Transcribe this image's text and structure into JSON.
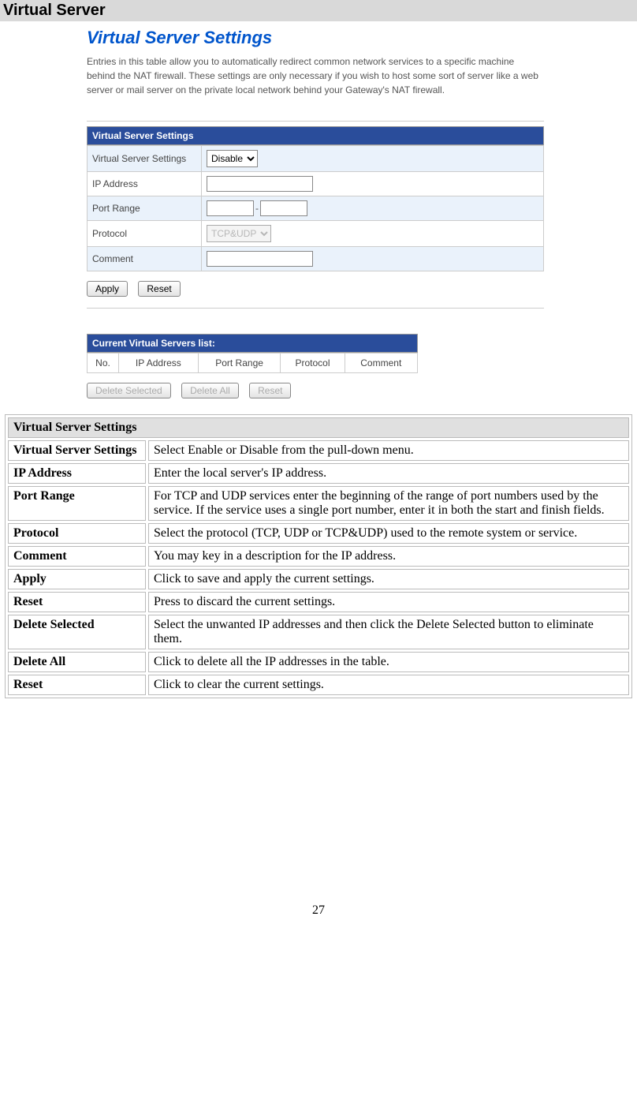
{
  "page_heading": "Virtual Server",
  "page_number": "27",
  "screenshot": {
    "title": "Virtual Server Settings",
    "description": "Entries in this table allow you to automatically redirect common network services to a specific machine behind the NAT firewall. These settings are only necessary if you wish to host some sort of server like a web server or mail server on the private local network behind your Gateway's NAT firewall.",
    "settings_header": "Virtual Server Settings",
    "rows": {
      "vss_label": "Virtual Server Settings",
      "vss_value": "Disable",
      "ip_label": "IP Address",
      "ip_value": "",
      "port_label": "Port Range",
      "port_start": "",
      "port_end": "",
      "proto_label": "Protocol",
      "proto_value": "TCP&UDP",
      "comment_label": "Comment",
      "comment_value": ""
    },
    "buttons": {
      "apply": "Apply",
      "reset": "Reset"
    },
    "list_header": "Current Virtual Servers list:",
    "list_cols": {
      "no": "No.",
      "ip": "IP Address",
      "port": "Port Range",
      "proto": "Protocol",
      "comment": "Comment"
    },
    "list_buttons": {
      "delete_selected": "Delete Selected",
      "delete_all": "Delete All",
      "reset": "Reset"
    }
  },
  "doc_table": {
    "header": "Virtual Server Settings",
    "rows": [
      {
        "term": "Virtual Server Settings",
        "desc": "Select Enable or Disable from the pull-down menu."
      },
      {
        "term": "IP Address",
        "desc": "Enter the local server's IP address."
      },
      {
        "term": "Port Range",
        "desc": "For TCP and UDP services enter the beginning of the range of port numbers used by the service. If the service uses a single port number, enter it in both the start and finish fields."
      },
      {
        "term": "Protocol",
        "desc": "Select the protocol (TCP, UDP or TCP&UDP) used to the remote system or service."
      },
      {
        "term": "Comment",
        "desc": "You may key in a description for the IP address."
      },
      {
        "term": "Apply",
        "desc": "Click to save and apply the current settings."
      },
      {
        "term": "Reset",
        "desc": "Press to discard the current settings."
      },
      {
        "term": "Delete Selected",
        "desc": "Select the unwanted IP addresses and then click the Delete Selected button to eliminate them."
      },
      {
        "term": "Delete All",
        "desc": "Click to delete all the IP addresses in the table."
      },
      {
        "term": "Reset",
        "desc": "Click to clear the current settings."
      }
    ]
  }
}
